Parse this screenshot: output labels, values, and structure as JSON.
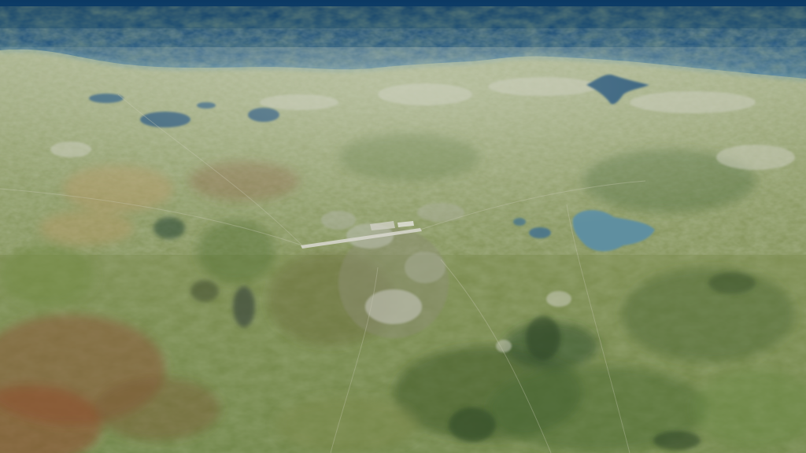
{
  "scene": {
    "kind": "aerial-flight-simulator-view",
    "colors": {
      "sea_deep": "#0c3a64",
      "sea_mid": "#1a5485",
      "sea_coast": "#2e6e99",
      "land_base": "#7e8e55",
      "land_far": "#a4ae86",
      "land_green": "#5f7a3c",
      "land_dark": "#445e30",
      "field_tan": "#b59a66",
      "field_brown": "#8a5a38",
      "field_red": "#8e4a2e",
      "town_grey": "#b8bcae",
      "lake_blue": "#3d6e8f",
      "lagoon_blue": "#5e8fa0",
      "runway": "#d6d6cc"
    }
  }
}
